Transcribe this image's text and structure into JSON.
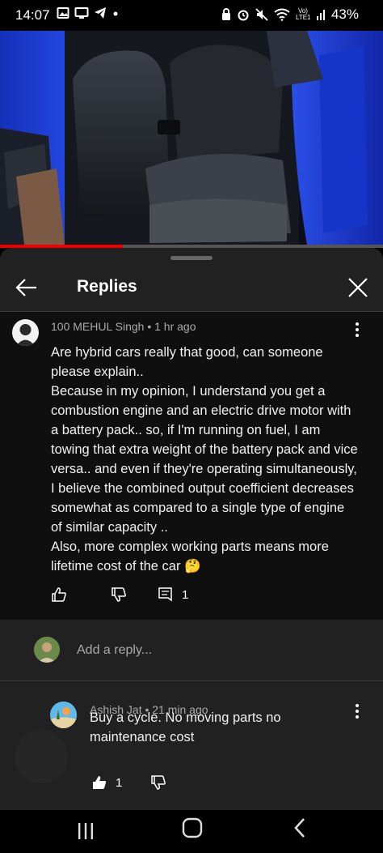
{
  "status_bar": {
    "time": "14:07",
    "network": "Vo) LTE1",
    "battery": "43%"
  },
  "video": {
    "progress": 0.32
  },
  "header": {
    "title": "Replies"
  },
  "comment": {
    "author": "100 MEHUL Singh",
    "time": "1 hr ago",
    "meta": "100 MEHUL Singh • 1 hr ago",
    "text": "Are hybrid cars really that good, can someone please explain..\nBecause in my opinion, I understand you get a combustion engine and an electric drive motor with a battery pack.. so, if I'm running on fuel, I am towing that extra weight of the battery pack and vice versa.. and even if they're operating simultaneously, I believe the combined output coefficient decreases somewhat as compared to a single type of engine of similar capacity ..\nAlso, more complex working parts means more lifetime cost of the car 🤔",
    "reply_count": "1"
  },
  "reply_input": {
    "placeholder": "Add a reply..."
  },
  "reply": {
    "author": "Ashish Jat",
    "time": "21 min ago",
    "meta": "Ashish Jat • 21 min ago",
    "text": "Buy a cycle. No moving parts no maintenance cost",
    "like_count": "1"
  },
  "colors": {
    "accent_red": "#ee0000",
    "sheet_bg": "#212121",
    "comment_bg": "#0f0f0f"
  }
}
